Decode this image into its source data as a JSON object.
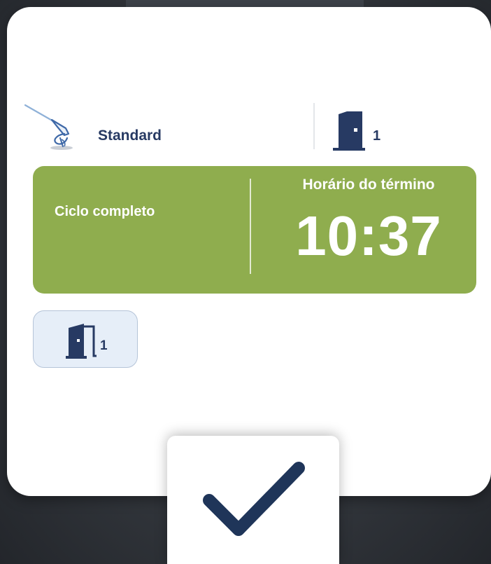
{
  "cycle": {
    "program_name": "Standard",
    "chamber_number": "1"
  },
  "status": {
    "text": "Ciclo completo",
    "end_time_label": "Horário do término",
    "end_time": "10:37",
    "color": "#8fad4e"
  },
  "door_button": {
    "number": "1",
    "icon": "open-door-icon"
  },
  "confirm_button": {
    "icon": "checkmark-icon"
  },
  "colors": {
    "navy": "#273a63",
    "green": "#8fad4e",
    "door_button_bg": "#e6eef8"
  }
}
